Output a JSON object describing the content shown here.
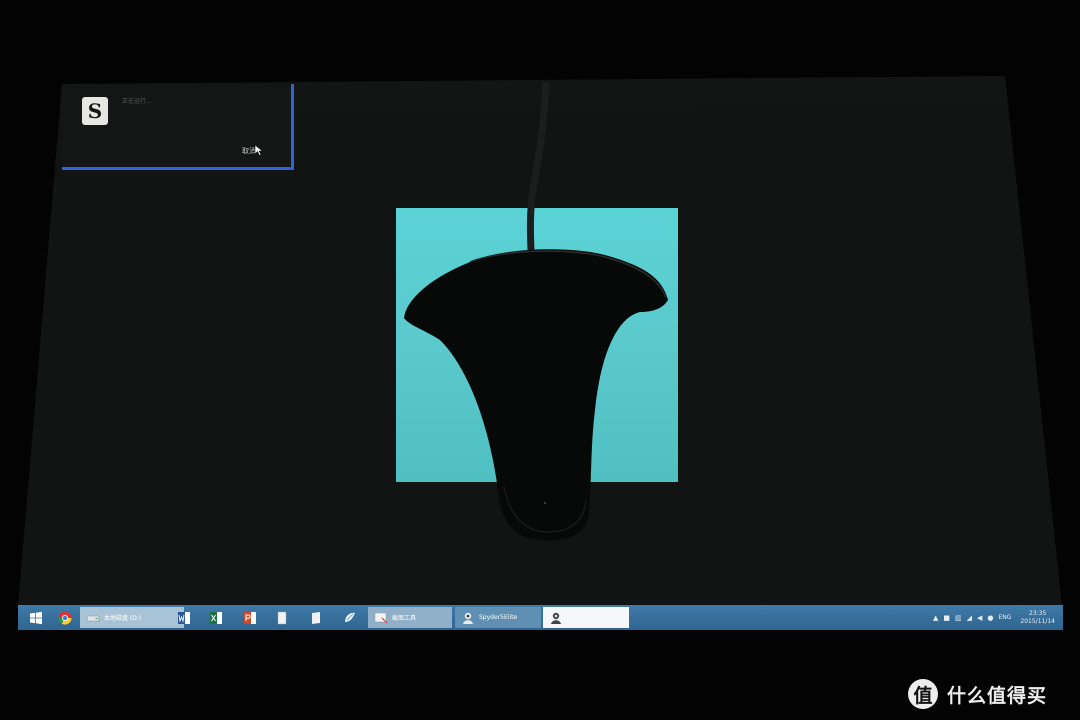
{
  "toast": {
    "message": "正在运行…",
    "cancel_label": "取消",
    "app_icon_glyph": "S"
  },
  "taskbar": {
    "explorer_label": "本地磁盘 (D:)",
    "tool_label": "截图工具",
    "spyder_label": "Spyder5Elite",
    "active_label": ""
  },
  "tray": {
    "language": "ENG",
    "time": "23:35",
    "date": "2015/11/14"
  },
  "watermark": {
    "logo_glyph": "值",
    "text": "什么值得买"
  },
  "colors": {
    "taskbar": "#3a729e",
    "toast_border": "#2f63d6",
    "calibration_patch": "#5acfd3"
  }
}
